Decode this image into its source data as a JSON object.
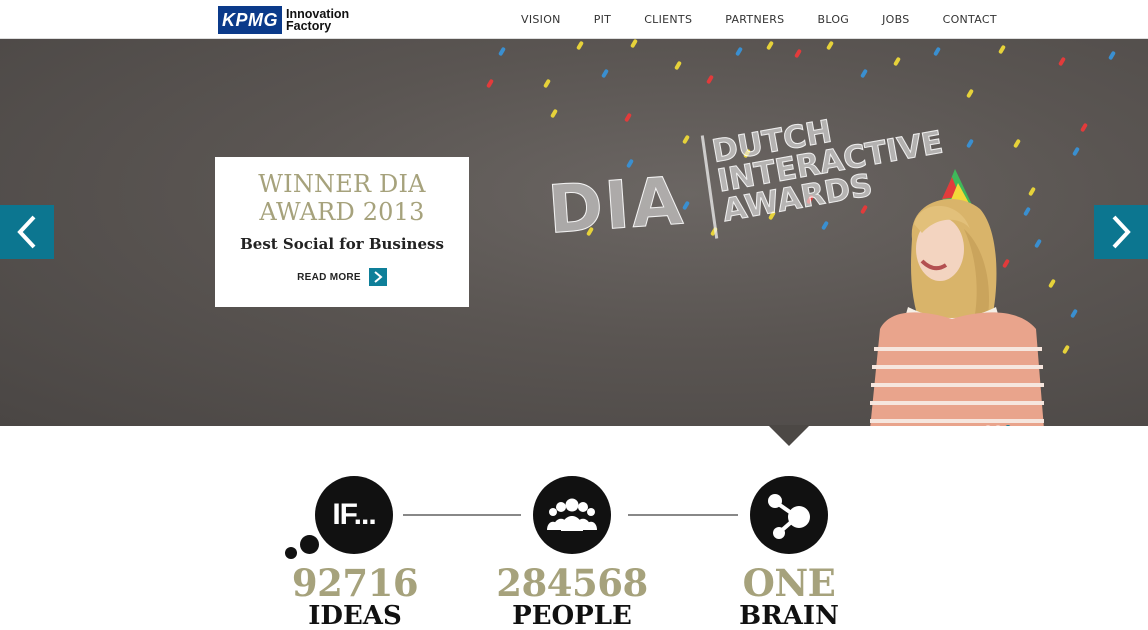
{
  "header": {
    "logo": {
      "brand": "KPMG",
      "line1": "Innovation",
      "line2": "Factory"
    },
    "nav": [
      "VISION",
      "PIT",
      "CLIENTS",
      "PARTNERS",
      "BLOG",
      "JOBS",
      "CONTACT"
    ]
  },
  "hero": {
    "chalk_left": "DIA",
    "chalk_right": [
      "DUTCH",
      "INTERACTIVE",
      "AWARDS"
    ],
    "card": {
      "title_line1": "WINNER DIA",
      "title_line2": "AWARD 2013",
      "subtitle": "Best Social for Business",
      "read_more": "READ MORE"
    },
    "arrows": {
      "prev": "chevron-left-icon",
      "next": "chevron-right-icon"
    },
    "slide_count": 3,
    "active_slide": 2
  },
  "stats": [
    {
      "icon": "if-thought-icon",
      "icon_text": "IF...",
      "number": "92716",
      "label": "IDEAS"
    },
    {
      "icon": "people-group-icon",
      "number": "284568",
      "label": "PEOPLE"
    },
    {
      "icon": "share-network-icon",
      "number": "ONE",
      "label": "BRAIN"
    }
  ],
  "colors": {
    "accent_teal": "#0c7690",
    "olive_text": "#a6a27c",
    "logo_blue": "#0b3a8a",
    "chalkboard": "#5a5552"
  }
}
